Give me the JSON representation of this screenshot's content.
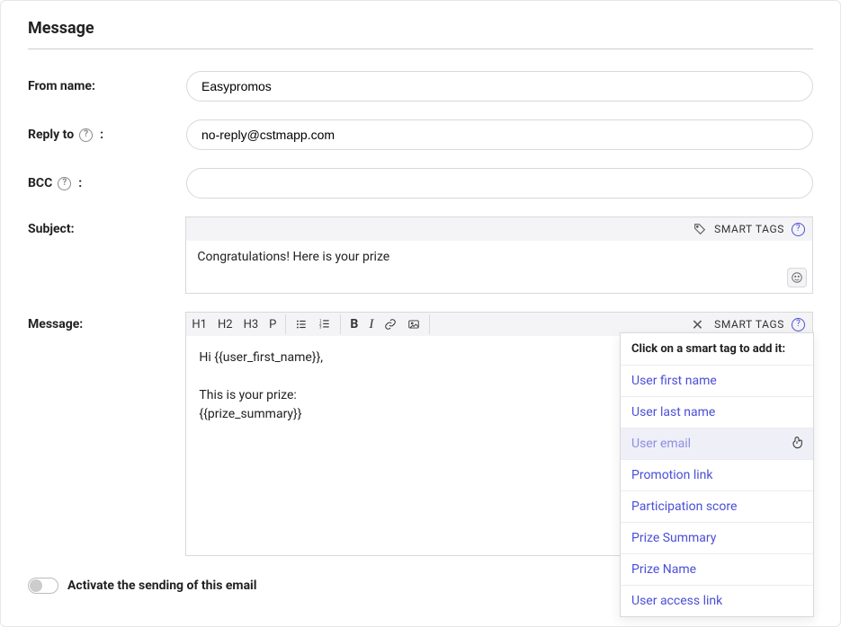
{
  "section_title": "Message",
  "labels": {
    "from_name": "From name:",
    "reply_to": "Reply to",
    "bcc": "BCC",
    "subject": "Subject:",
    "message": "Message:"
  },
  "from_name_value": "Easypromos",
  "reply_to_value": "no-reply@cstmapp.com",
  "bcc_value": "",
  "subject_value": "Congratulations! Here is your prize",
  "smart_tags_label": "SMART TAGS",
  "toolbar": {
    "h1": "H1",
    "h2": "H2",
    "h3": "H3",
    "p": "P",
    "b": "B",
    "i": "I"
  },
  "message_body": "Hi {{user_first_name}},\n\nThis is your prize:\n{{prize_summary}}",
  "smart_panel": {
    "header": "Click on a smart tag to add it:",
    "items": [
      "User first name",
      "User last name",
      "User email",
      "Promotion link",
      "Participation score",
      "Prize Summary",
      "Prize Name",
      "User access link"
    ],
    "hover_index": 2
  },
  "activate_label": "Activate the sending of this email"
}
